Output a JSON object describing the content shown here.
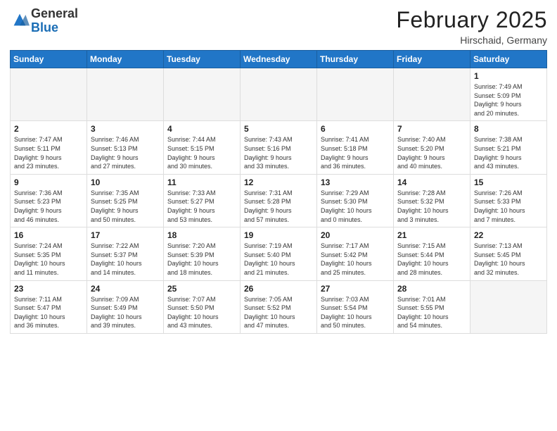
{
  "header": {
    "logo_general": "General",
    "logo_blue": "Blue",
    "month_title": "February 2025",
    "location": "Hirschaid, Germany"
  },
  "days_of_week": [
    "Sunday",
    "Monday",
    "Tuesday",
    "Wednesday",
    "Thursday",
    "Friday",
    "Saturday"
  ],
  "weeks": [
    [
      {
        "day": "",
        "info": ""
      },
      {
        "day": "",
        "info": ""
      },
      {
        "day": "",
        "info": ""
      },
      {
        "day": "",
        "info": ""
      },
      {
        "day": "",
        "info": ""
      },
      {
        "day": "",
        "info": ""
      },
      {
        "day": "1",
        "info": "Sunrise: 7:49 AM\nSunset: 5:09 PM\nDaylight: 9 hours\nand 20 minutes."
      }
    ],
    [
      {
        "day": "2",
        "info": "Sunrise: 7:47 AM\nSunset: 5:11 PM\nDaylight: 9 hours\nand 23 minutes."
      },
      {
        "day": "3",
        "info": "Sunrise: 7:46 AM\nSunset: 5:13 PM\nDaylight: 9 hours\nand 27 minutes."
      },
      {
        "day": "4",
        "info": "Sunrise: 7:44 AM\nSunset: 5:15 PM\nDaylight: 9 hours\nand 30 minutes."
      },
      {
        "day": "5",
        "info": "Sunrise: 7:43 AM\nSunset: 5:16 PM\nDaylight: 9 hours\nand 33 minutes."
      },
      {
        "day": "6",
        "info": "Sunrise: 7:41 AM\nSunset: 5:18 PM\nDaylight: 9 hours\nand 36 minutes."
      },
      {
        "day": "7",
        "info": "Sunrise: 7:40 AM\nSunset: 5:20 PM\nDaylight: 9 hours\nand 40 minutes."
      },
      {
        "day": "8",
        "info": "Sunrise: 7:38 AM\nSunset: 5:21 PM\nDaylight: 9 hours\nand 43 minutes."
      }
    ],
    [
      {
        "day": "9",
        "info": "Sunrise: 7:36 AM\nSunset: 5:23 PM\nDaylight: 9 hours\nand 46 minutes."
      },
      {
        "day": "10",
        "info": "Sunrise: 7:35 AM\nSunset: 5:25 PM\nDaylight: 9 hours\nand 50 minutes."
      },
      {
        "day": "11",
        "info": "Sunrise: 7:33 AM\nSunset: 5:27 PM\nDaylight: 9 hours\nand 53 minutes."
      },
      {
        "day": "12",
        "info": "Sunrise: 7:31 AM\nSunset: 5:28 PM\nDaylight: 9 hours\nand 57 minutes."
      },
      {
        "day": "13",
        "info": "Sunrise: 7:29 AM\nSunset: 5:30 PM\nDaylight: 10 hours\nand 0 minutes."
      },
      {
        "day": "14",
        "info": "Sunrise: 7:28 AM\nSunset: 5:32 PM\nDaylight: 10 hours\nand 3 minutes."
      },
      {
        "day": "15",
        "info": "Sunrise: 7:26 AM\nSunset: 5:33 PM\nDaylight: 10 hours\nand 7 minutes."
      }
    ],
    [
      {
        "day": "16",
        "info": "Sunrise: 7:24 AM\nSunset: 5:35 PM\nDaylight: 10 hours\nand 11 minutes."
      },
      {
        "day": "17",
        "info": "Sunrise: 7:22 AM\nSunset: 5:37 PM\nDaylight: 10 hours\nand 14 minutes."
      },
      {
        "day": "18",
        "info": "Sunrise: 7:20 AM\nSunset: 5:39 PM\nDaylight: 10 hours\nand 18 minutes."
      },
      {
        "day": "19",
        "info": "Sunrise: 7:19 AM\nSunset: 5:40 PM\nDaylight: 10 hours\nand 21 minutes."
      },
      {
        "day": "20",
        "info": "Sunrise: 7:17 AM\nSunset: 5:42 PM\nDaylight: 10 hours\nand 25 minutes."
      },
      {
        "day": "21",
        "info": "Sunrise: 7:15 AM\nSunset: 5:44 PM\nDaylight: 10 hours\nand 28 minutes."
      },
      {
        "day": "22",
        "info": "Sunrise: 7:13 AM\nSunset: 5:45 PM\nDaylight: 10 hours\nand 32 minutes."
      }
    ],
    [
      {
        "day": "23",
        "info": "Sunrise: 7:11 AM\nSunset: 5:47 PM\nDaylight: 10 hours\nand 36 minutes."
      },
      {
        "day": "24",
        "info": "Sunrise: 7:09 AM\nSunset: 5:49 PM\nDaylight: 10 hours\nand 39 minutes."
      },
      {
        "day": "25",
        "info": "Sunrise: 7:07 AM\nSunset: 5:50 PM\nDaylight: 10 hours\nand 43 minutes."
      },
      {
        "day": "26",
        "info": "Sunrise: 7:05 AM\nSunset: 5:52 PM\nDaylight: 10 hours\nand 47 minutes."
      },
      {
        "day": "27",
        "info": "Sunrise: 7:03 AM\nSunset: 5:54 PM\nDaylight: 10 hours\nand 50 minutes."
      },
      {
        "day": "28",
        "info": "Sunrise: 7:01 AM\nSunset: 5:55 PM\nDaylight: 10 hours\nand 54 minutes."
      },
      {
        "day": "",
        "info": ""
      }
    ]
  ]
}
